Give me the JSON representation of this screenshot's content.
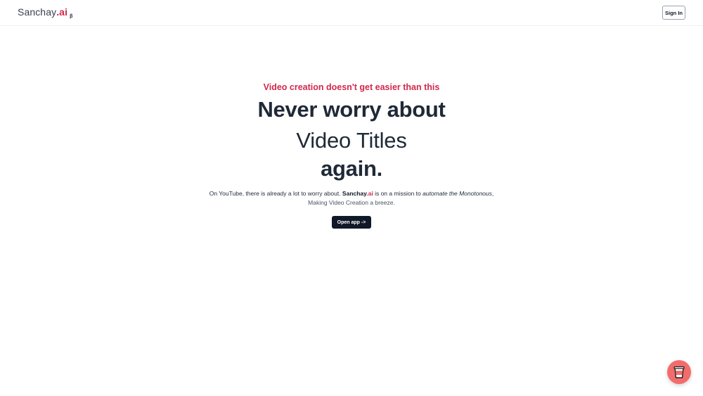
{
  "header": {
    "logo_name": "Sanchay",
    "logo_suffix": ".ai",
    "logo_badge": "β",
    "signin_label": "Sign In"
  },
  "hero": {
    "eyebrow": "Video creation doesn't get easier than this",
    "headline_1": "Never worry about",
    "rotating_phrase": "Video Titles",
    "headline_2": "again.",
    "description": {
      "part1": "On YouTube, there is already a lot to worry about. ",
      "brand_name": "Sanchay",
      "brand_suffix": ".ai",
      "part2": " is on a mission to ",
      "emphasis": "automate the Monotonous",
      "part3": ",",
      "line2": "Making Video Creation a breeze."
    },
    "cta_label": "Open app ->"
  },
  "widget": {
    "icon": "coffee-cup-icon",
    "color": "#f36c6c"
  },
  "colors": {
    "accent": "#d1284b",
    "dark": "#111827"
  }
}
